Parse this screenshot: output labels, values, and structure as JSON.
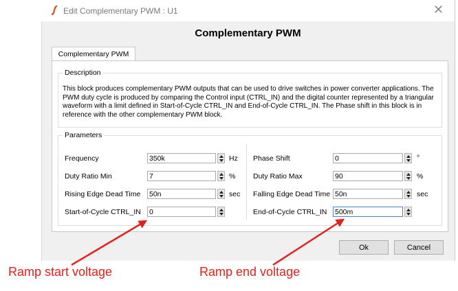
{
  "window": {
    "title": "Edit Complementary PWM : U1",
    "close_glyph": "✕"
  },
  "heading": "Complementary PWM",
  "tab": {
    "label": "Complementary PWM"
  },
  "description": {
    "label": "Description",
    "text": "This block produces complementary PWM outputs that can be used to drive switches in power converter applications. The PWM duty cycle is produced by comparing the Control input (CTRL_IN) and the digital counter represented by a triangular waveform with a limit defined in Start-of-Cycle CTRL_IN and End-of-Cycle CTRL_IN. The Phase shift in this block is in reference with the other complementary PWM block."
  },
  "parameters": {
    "label": "Parameters",
    "left": [
      {
        "label": "Frequency",
        "value": "350k",
        "unit": "Hz"
      },
      {
        "label": "Duty Ratio Min",
        "value": "7",
        "unit": "%"
      },
      {
        "label": "Rising Edge Dead Time",
        "value": "50n",
        "unit": "sec"
      },
      {
        "label": "Start-of-Cycle CTRL_IN",
        "value": "0",
        "unit": ""
      }
    ],
    "right": [
      {
        "label": "Phase Shift",
        "value": "0",
        "unit": "°"
      },
      {
        "label": "Duty Ratio Max",
        "value": "90",
        "unit": "%"
      },
      {
        "label": "Falling Edge Dead Time",
        "value": "50n",
        "unit": "sec"
      },
      {
        "label": "End-of-Cycle CTRL_IN",
        "value": "500m",
        "unit": ""
      }
    ]
  },
  "buttons": {
    "ok": "Ok",
    "cancel": "Cancel"
  },
  "annotations": {
    "start": "Ramp start voltage",
    "end": "Ramp end voltage",
    "color": "#e2211c"
  },
  "icons": {
    "app": "simetrix-logo-icon",
    "close": "close-icon",
    "spin": "spin-arrows-icon"
  }
}
